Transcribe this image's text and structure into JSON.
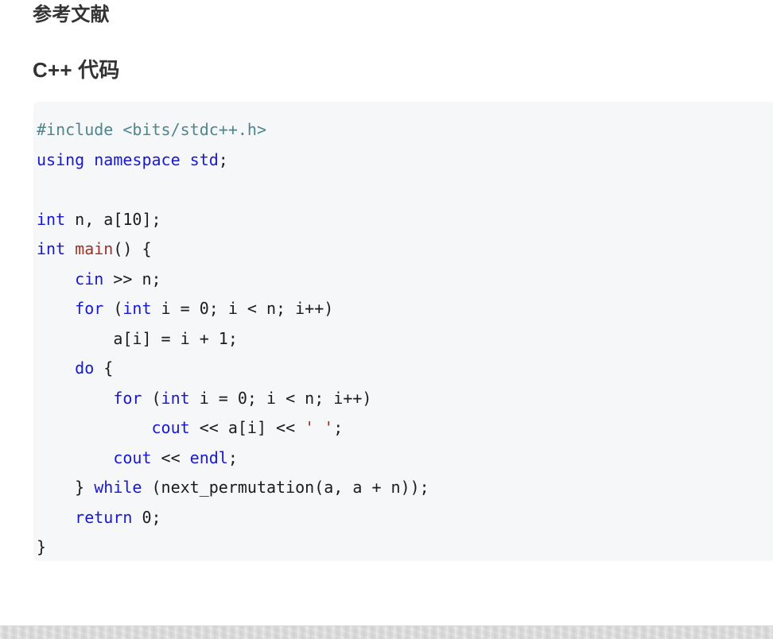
{
  "document": {
    "headings": [
      {
        "id": "references",
        "text": "参考文献",
        "level": 2
      },
      {
        "id": "cpp-code",
        "text": "C++ 代码",
        "level": 2
      }
    ]
  },
  "code_block": {
    "language": "cpp",
    "background_color": "#f6f7f9",
    "plain_text": "#include <bits/stdc++.h>\nusing namespace std;\n\nint n, a[10];\nint main() {\n    cin >> n;\n    for (int i = 0; i < n; i++)\n        a[i] = i + 1;\n    do {\n        for (int i = 0; i < n; i++)\n            cout << a[i] << ' ';\n        cout << endl;\n    } while (next_permutation(a, a + n));\n    return 0;\n}",
    "token_colors": {
      "preprocessor": "#4f868d",
      "keyword": "#1717d6",
      "function": "#9d3127",
      "string": "#9d3127",
      "plain": "#1c1c1c"
    },
    "lines": [
      {
        "n": 1,
        "tokens": [
          {
            "t": "#include <bits/stdc++.h>",
            "c": "tok-pre"
          }
        ]
      },
      {
        "n": 2,
        "tokens": [
          {
            "t": "using namespace std",
            "c": "tok-kw"
          },
          {
            "t": ";",
            "c": "tok-plain"
          }
        ]
      },
      {
        "n": 3,
        "tokens": [
          {
            "t": "",
            "c": "tok-plain"
          }
        ]
      },
      {
        "n": 4,
        "tokens": [
          {
            "t": "int",
            "c": "tok-kw"
          },
          {
            "t": " n, a[10];",
            "c": "tok-plain"
          }
        ]
      },
      {
        "n": 5,
        "tokens": [
          {
            "t": "int",
            "c": "tok-kw"
          },
          {
            "t": " ",
            "c": "tok-plain"
          },
          {
            "t": "main",
            "c": "tok-fn"
          },
          {
            "t": "() {",
            "c": "tok-plain"
          }
        ]
      },
      {
        "n": 6,
        "tokens": [
          {
            "t": "    ",
            "c": "tok-plain"
          },
          {
            "t": "cin",
            "c": "tok-kw"
          },
          {
            "t": " >> n;",
            "c": "tok-plain"
          }
        ]
      },
      {
        "n": 7,
        "tokens": [
          {
            "t": "    ",
            "c": "tok-plain"
          },
          {
            "t": "for",
            "c": "tok-kw"
          },
          {
            "t": " (",
            "c": "tok-plain"
          },
          {
            "t": "int",
            "c": "tok-kw"
          },
          {
            "t": " i = 0; i < n; i++)",
            "c": "tok-plain"
          }
        ]
      },
      {
        "n": 8,
        "tokens": [
          {
            "t": "        a[i] = i + 1;",
            "c": "tok-plain"
          }
        ]
      },
      {
        "n": 9,
        "tokens": [
          {
            "t": "    ",
            "c": "tok-plain"
          },
          {
            "t": "do",
            "c": "tok-kw"
          },
          {
            "t": " {",
            "c": "tok-plain"
          }
        ]
      },
      {
        "n": 10,
        "tokens": [
          {
            "t": "        ",
            "c": "tok-plain"
          },
          {
            "t": "for",
            "c": "tok-kw"
          },
          {
            "t": " (",
            "c": "tok-plain"
          },
          {
            "t": "int",
            "c": "tok-kw"
          },
          {
            "t": " i = 0; i < n; i++)",
            "c": "tok-plain"
          }
        ]
      },
      {
        "n": 11,
        "tokens": [
          {
            "t": "            ",
            "c": "tok-plain"
          },
          {
            "t": "cout",
            "c": "tok-kw"
          },
          {
            "t": " << a[i] << ",
            "c": "tok-plain"
          },
          {
            "t": "' '",
            "c": "tok-str"
          },
          {
            "t": ";",
            "c": "tok-plain"
          }
        ]
      },
      {
        "n": 12,
        "tokens": [
          {
            "t": "        ",
            "c": "tok-plain"
          },
          {
            "t": "cout",
            "c": "tok-kw"
          },
          {
            "t": " << ",
            "c": "tok-plain"
          },
          {
            "t": "endl",
            "c": "tok-kw"
          },
          {
            "t": ";",
            "c": "tok-plain"
          }
        ]
      },
      {
        "n": 13,
        "tokens": [
          {
            "t": "    } ",
            "c": "tok-plain"
          },
          {
            "t": "while",
            "c": "tok-kw"
          },
          {
            "t": " (next_permutation(a, a + n));",
            "c": "tok-plain"
          }
        ]
      },
      {
        "n": 14,
        "tokens": [
          {
            "t": "    ",
            "c": "tok-plain"
          },
          {
            "t": "return",
            "c": "tok-kw"
          },
          {
            "t": " 0;",
            "c": "tok-plain"
          }
        ]
      },
      {
        "n": 15,
        "tokens": [
          {
            "t": "}",
            "c": "tok-plain"
          }
        ]
      }
    ]
  },
  "bottom_bar": {
    "color": "#dededf"
  }
}
